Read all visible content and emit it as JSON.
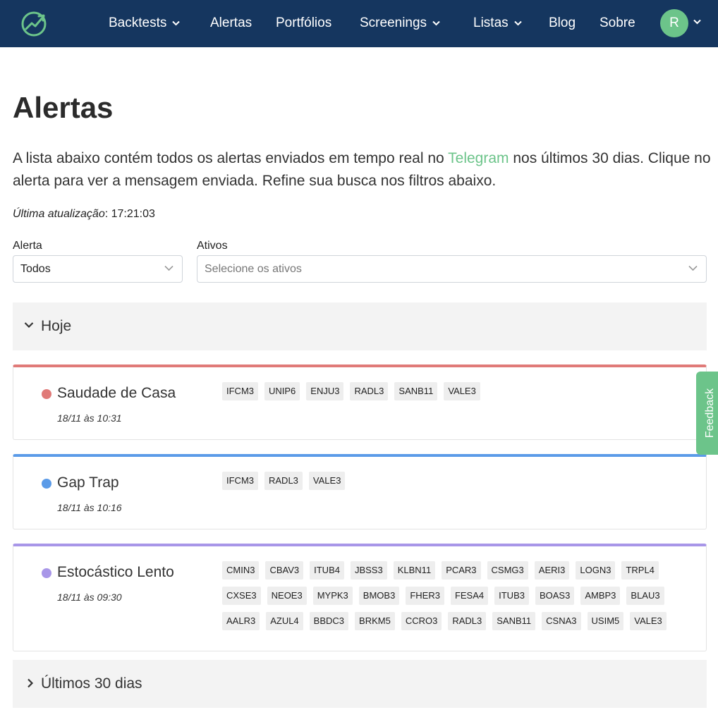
{
  "nav": {
    "items": [
      {
        "label": "Backtests",
        "dropdown": true
      },
      {
        "label": "Alertas",
        "dropdown": false
      },
      {
        "label": "Portfólios",
        "dropdown": false
      },
      {
        "label": "Screenings",
        "dropdown": true
      },
      {
        "label": "Listas",
        "dropdown": true
      },
      {
        "label": "Blog",
        "dropdown": false
      },
      {
        "label": "Sobre",
        "dropdown": false
      }
    ],
    "avatar_initial": "R"
  },
  "page": {
    "title": "Alertas",
    "intro_before": "A lista abaixo contém todos os alertas enviados em tempo real no ",
    "intro_link": "Telegram",
    "intro_after": " nos últimos 30 dias. Clique no alerta para ver a mensagem enviada. Refine sua busca nos filtros abaixo.",
    "updated_label": "Última atualização",
    "updated_sep": ": ",
    "updated_time": "17:21:03"
  },
  "filters": {
    "alert_label": "Alerta",
    "alert_value": "Todos",
    "assets_label": "Ativos",
    "assets_placeholder": "Selecione os ativos"
  },
  "groups": {
    "today": "Hoje",
    "last30": "Últimos 30 dias"
  },
  "alerts": [
    {
      "name": "Saudade de Casa",
      "time": "18/11 às 10:31",
      "color": "#e07a78",
      "tickers": [
        "IFCM3",
        "UNIP6",
        "ENJU3",
        "RADL3",
        "SANB11",
        "VALE3"
      ]
    },
    {
      "name": "Gap Trap",
      "time": "18/11 às 10:16",
      "color": "#5b9be8",
      "tickers": [
        "IFCM3",
        "RADL3",
        "VALE3"
      ]
    },
    {
      "name": "Estocástico Lento",
      "time": "18/11 às 09:30",
      "color": "#a896e8",
      "tickers": [
        "CMIN3",
        "CBAV3",
        "ITUB4",
        "JBSS3",
        "KLBN11",
        "PCAR3",
        "CSMG3",
        "AERI3",
        "LOGN3",
        "TRPL4",
        "CXSE3",
        "NEOE3",
        "MYPK3",
        "BMOB3",
        "FHER3",
        "FESA4",
        "ITUB3",
        "BOAS3",
        "AMBP3",
        "BLAU3",
        "AALR3",
        "AZUL4",
        "BBDC3",
        "BRKM5",
        "CCRO3",
        "RADL3",
        "SANB11",
        "CSNA3",
        "USIM5",
        "VALE3"
      ]
    }
  ],
  "feedback_label": "Feedback",
  "colors": {
    "navbar": "#15365f",
    "accent": "#6cc48a"
  }
}
